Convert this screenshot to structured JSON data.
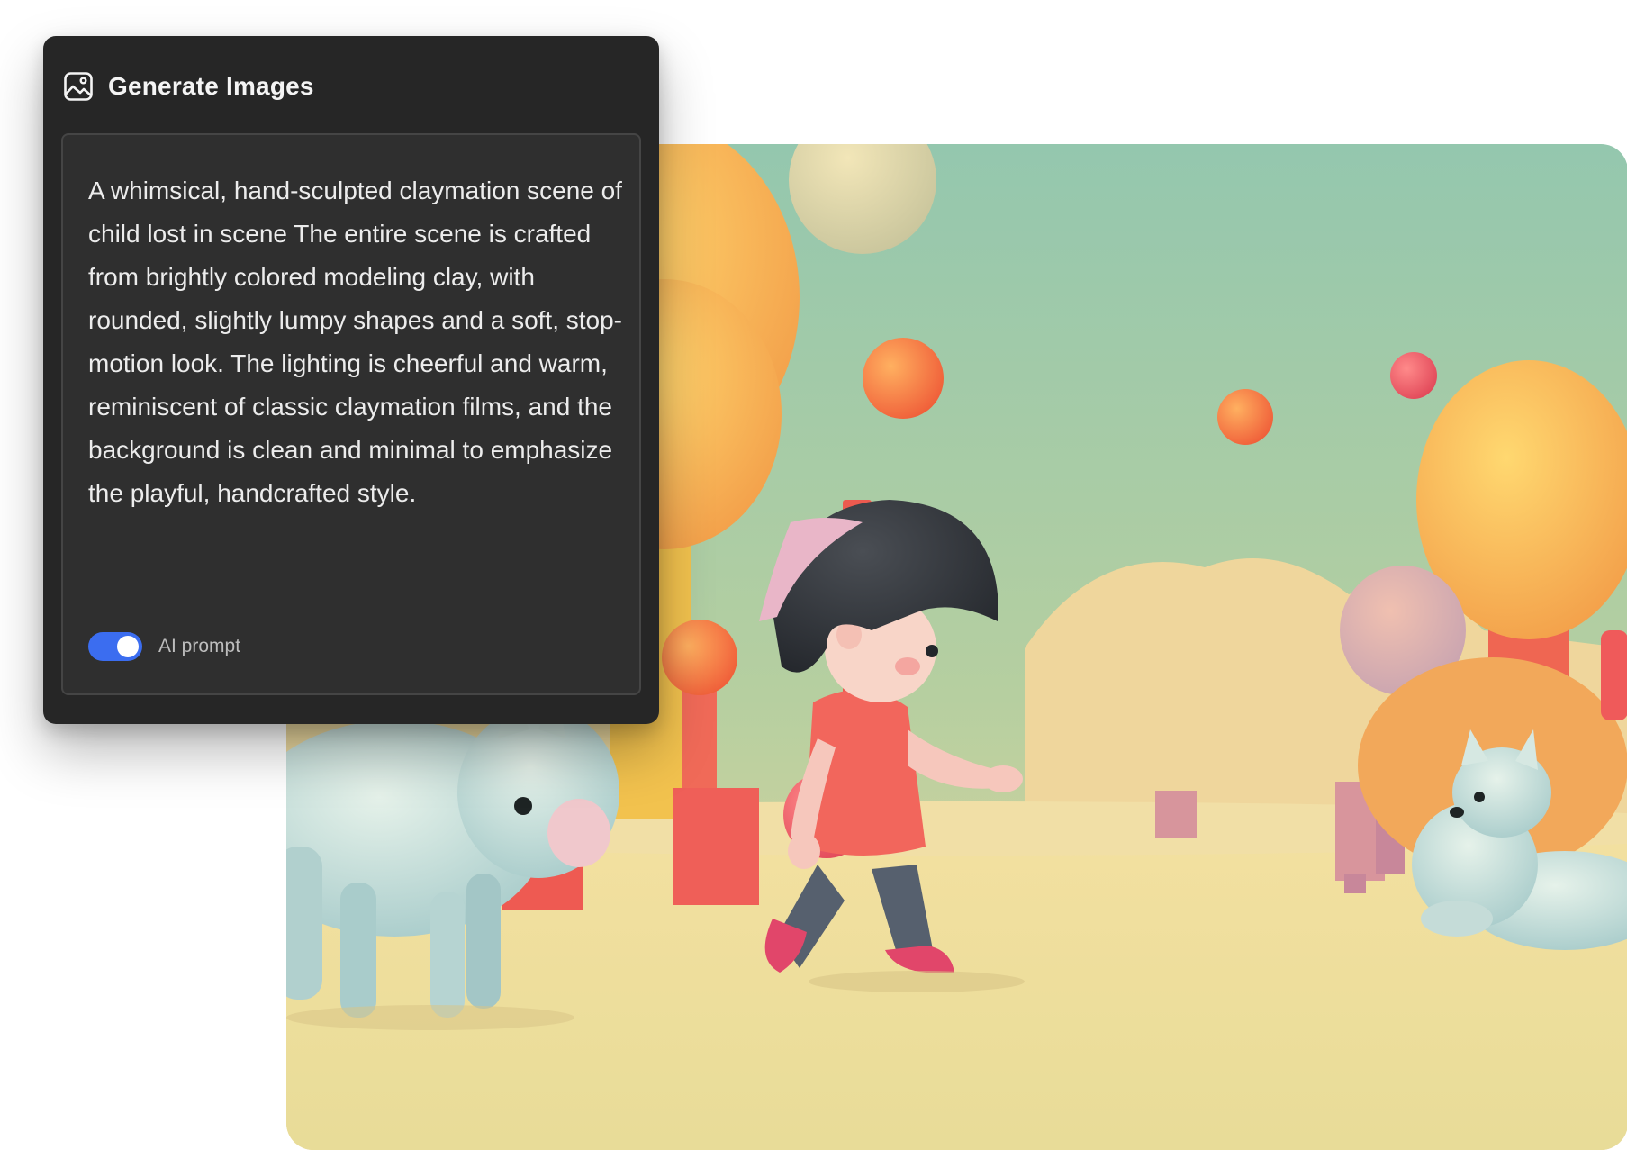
{
  "panel": {
    "title": "Generate Images",
    "icon": "image-icon",
    "prompt": "A whimsical, hand-sculpted claymation scene of child lost in scene The entire scene is crafted from brightly colored modeling clay, with rounded, slightly lumpy shapes and a soft, stop-motion look. The lighting is cheerful and warm, reminiscent of classic claymation films, and the background is clean and minimal to emphasize the playful, handcrafted style.",
    "toggle": {
      "label": "AI prompt",
      "on": true,
      "color": "#3b6df0"
    }
  },
  "colors": {
    "panel_background": "#262626",
    "prompt_background": "#2f2f2f",
    "sky": "#9cc9ad",
    "ground": "#efdfa0"
  }
}
